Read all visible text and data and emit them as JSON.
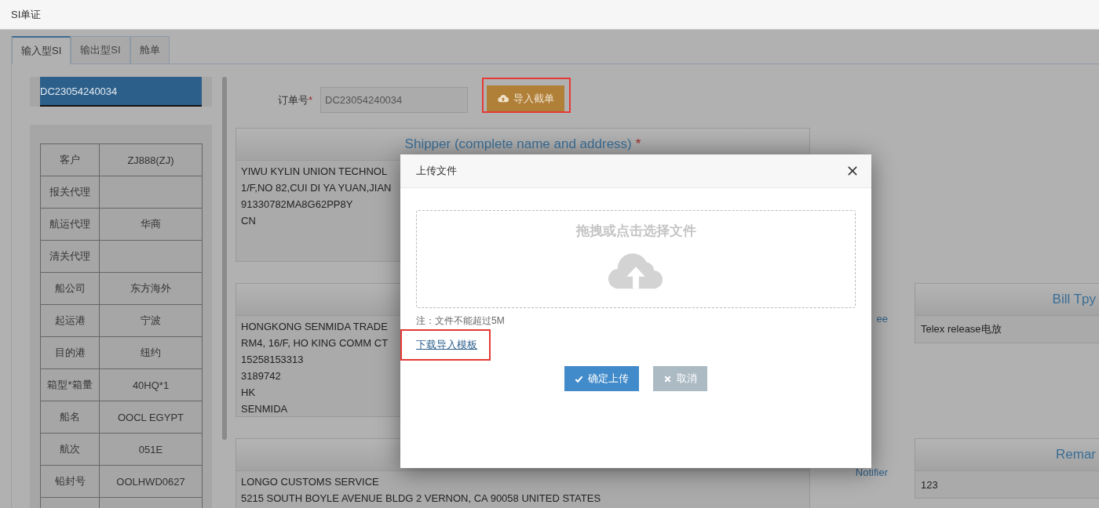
{
  "header": {
    "title": "SI单证"
  },
  "tabs": [
    {
      "label": "输入型SI",
      "selected": true
    },
    {
      "label": "输出型SI",
      "selected": false
    },
    {
      "label": "舱单",
      "selected": false
    }
  ],
  "orders": [
    {
      "number": "DC23054240034",
      "selected": true
    }
  ],
  "info_table": [
    {
      "label": "客户",
      "value": "ZJ888(ZJ)"
    },
    {
      "label": "报关代理"
    },
    {
      "label": "航运代理",
      "value": "华商"
    },
    {
      "label": "清关代理"
    },
    {
      "label": "船公司",
      "value": "东方海外"
    },
    {
      "label": "起运港",
      "value": "宁波"
    },
    {
      "label": "目的港",
      "value": "纽约"
    },
    {
      "label": "箱型*箱量",
      "value": "40HQ*1"
    },
    {
      "label": "船名",
      "value": "OOCL EGYPT"
    },
    {
      "label": "航次",
      "value": "051E"
    },
    {
      "label": "铅封号",
      "value": "OOLHWD0627"
    }
  ],
  "order_field": {
    "label": "订单号",
    "required_mark": "*",
    "value": "DC23054240034",
    "disabled": true
  },
  "import_button": {
    "label": "导入截单",
    "highlighted": true
  },
  "sections": [
    {
      "title": "Shipper (complete name and address)",
      "required_mark": "*",
      "lines": [
        "YIWU KYLIN UNION TECHNOL",
        "1/F,NO 82,CUI DI YA YUAN,JIAN",
        "91330782MA8G62PP8Y",
        "CN"
      ]
    },
    {
      "lines": [
        "HONGKONG SENMIDA TRADE",
        "RM4, 16/F, HO KING COMM CT",
        "15258153313",
        "3189742",
        "HK",
        "SENMIDA"
      ],
      "side_label": "ee",
      "side_box": {
        "title": "Bill Tpy",
        "value": "Telex release电放"
      }
    },
    {
      "lines": [
        "LONGO CUSTOMS SERVICE",
        "5215 SOUTH BOYLE AVENUE BLDG 2 VERNON, CA 90058 UNITED STATES"
      ],
      "side_label": "Notifier",
      "side_box": {
        "title": "Remar",
        "value": "123"
      }
    }
  ],
  "modal": {
    "title": "上传文件",
    "drop_text": "拖拽或点击选择文件",
    "note": "注：文件不能超过5M",
    "template_link": {
      "label": "下载导入模板",
      "highlighted": true
    },
    "buttons": [
      {
        "label": "确定上传",
        "kind": "primary"
      },
      {
        "label": "取消",
        "kind": "cancel"
      }
    ]
  }
}
